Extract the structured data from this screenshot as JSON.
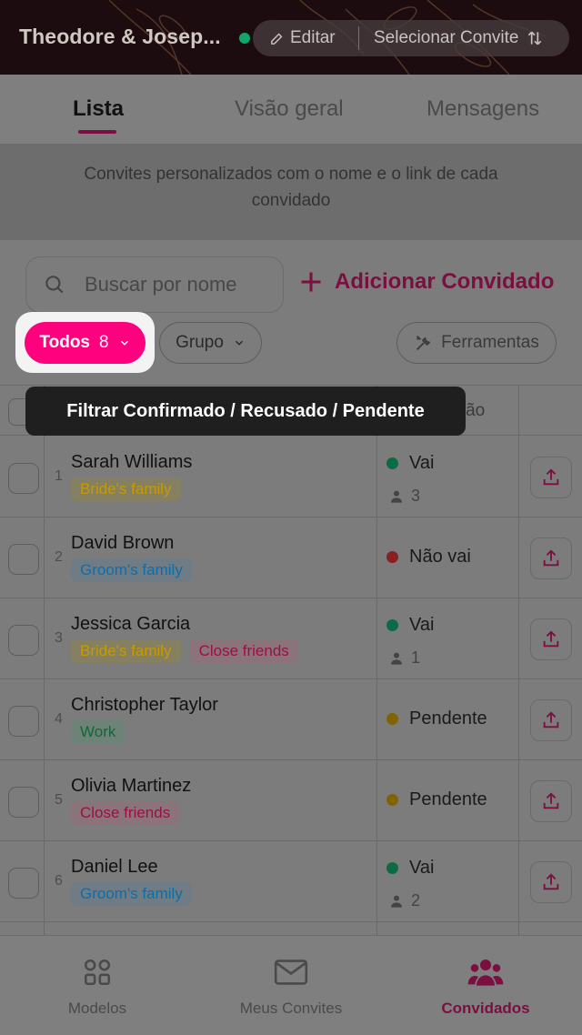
{
  "header": {
    "title": "Theodore & Josep...",
    "edit_label": "Editar",
    "select_label": "Selecionar Convite"
  },
  "tabs": [
    {
      "label": "Lista",
      "active": true
    },
    {
      "label": "Visão geral",
      "active": false
    },
    {
      "label": "Mensagens",
      "active": false
    }
  ],
  "info_banner": "Convites personalizados com o nome e o link de cada convidado",
  "search": {
    "placeholder": "Buscar por nome"
  },
  "add_guest_label": "Adicionar Convidado",
  "filters": {
    "todos_label": "Todos",
    "todos_count": "8",
    "group_label": "Grupo",
    "tools_label": "Ferramentas"
  },
  "table": {
    "status_header": "ação",
    "rows": [
      {
        "index": "1",
        "name": "Sarah Williams",
        "tags": [
          "Bride's family"
        ],
        "status": "Vai",
        "status_kind": "go",
        "guests": "3"
      },
      {
        "index": "2",
        "name": "David Brown",
        "tags": [
          "Groom's family"
        ],
        "status": "Não vai",
        "status_kind": "no",
        "guests": ""
      },
      {
        "index": "3",
        "name": "Jessica Garcia",
        "tags": [
          "Bride's family",
          "Close friends"
        ],
        "status": "Vai",
        "status_kind": "go",
        "guests": "1"
      },
      {
        "index": "4",
        "name": "Christopher Taylor",
        "tags": [
          "Work"
        ],
        "status": "Pendente",
        "status_kind": "pend",
        "guests": ""
      },
      {
        "index": "5",
        "name": "Olivia Martinez",
        "tags": [
          "Close friends"
        ],
        "status": "Pendente",
        "status_kind": "pend",
        "guests": ""
      },
      {
        "index": "6",
        "name": "Daniel Lee",
        "tags": [
          "Groom's family"
        ],
        "status": "Vai",
        "status_kind": "go",
        "guests": "2"
      }
    ]
  },
  "tooltip": "Filtrar Confirmado / Recusado / Pendente",
  "bottom_nav": [
    {
      "label": "Modelos",
      "icon": "grid-icon",
      "active": false
    },
    {
      "label": "Meus Convites",
      "icon": "envelope-icon",
      "active": false
    },
    {
      "label": "Convidados",
      "icon": "people-icon",
      "active": true
    }
  ],
  "colors": {
    "accent": "#ff007f",
    "accent_dim": "#7a0f40",
    "status_go": "#10a86a",
    "status_no": "#e04848",
    "status_pending": "#e0b000"
  }
}
